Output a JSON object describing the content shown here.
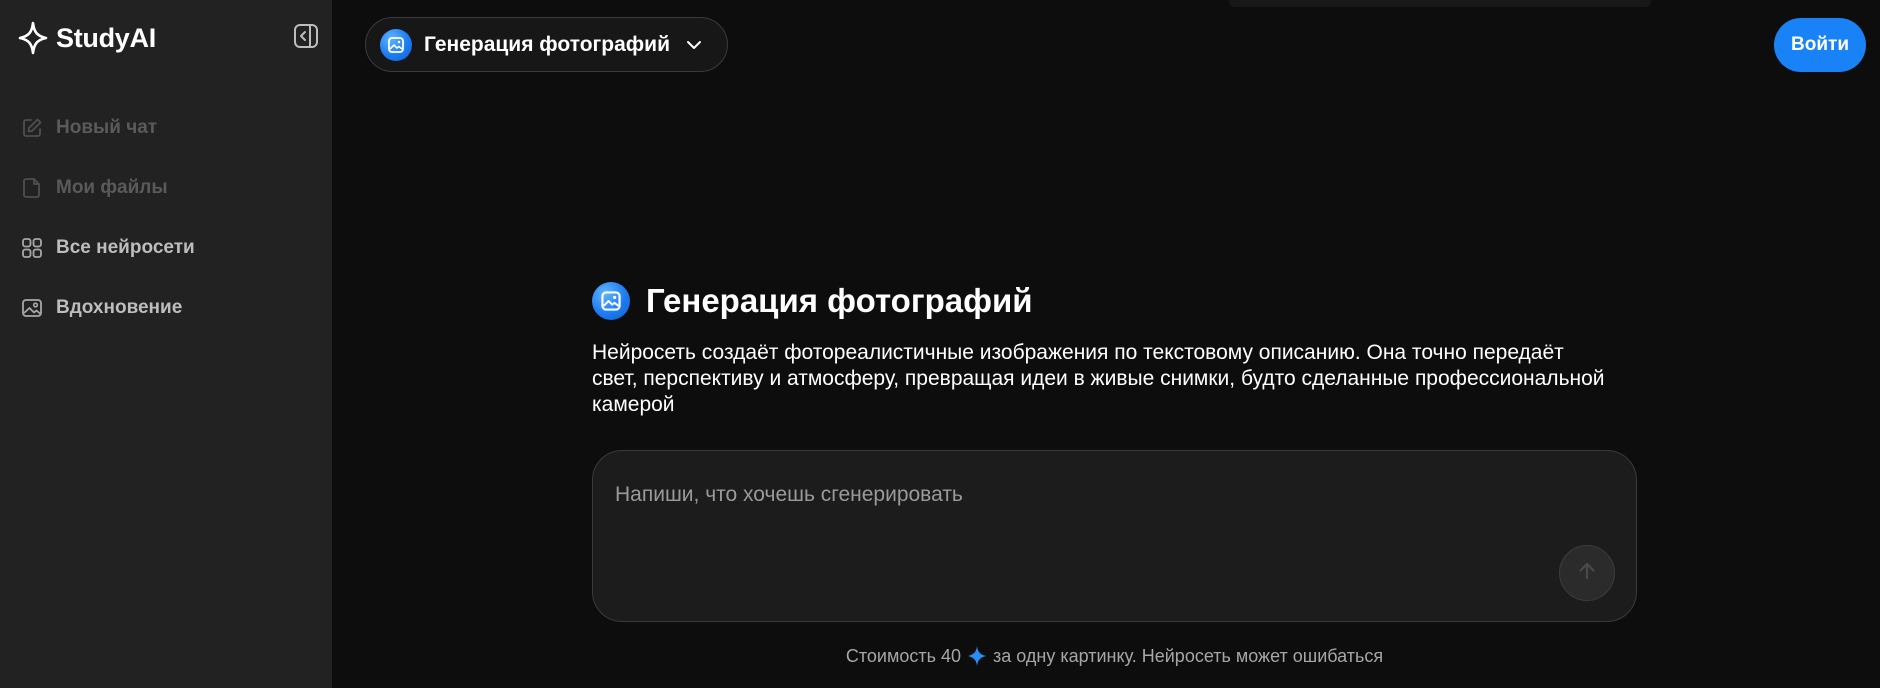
{
  "brand": {
    "name": "StudyAI"
  },
  "sidebar": {
    "items": [
      {
        "label": "Новый чат",
        "icon": "edit-icon",
        "state": "disabled"
      },
      {
        "label": "Мои файлы",
        "icon": "file-icon",
        "state": "disabled"
      },
      {
        "label": "Все нейросети",
        "icon": "grid-icon",
        "state": "enabled"
      },
      {
        "label": "Вдохновение",
        "icon": "image-icon",
        "state": "enabled"
      }
    ]
  },
  "header": {
    "model_select": {
      "label": "Генерация фотографий",
      "icon": "photo-badge-icon"
    },
    "login_label": "Войти"
  },
  "main": {
    "title": "Генерация фотографий",
    "description": "Нейросеть создаёт фотореалистичные изображения по текстовому описанию. Она точно передаёт свет, перспективу и атмосферу, превращая идеи в живые снимки, будто сделанные профессиональной камерой",
    "prompt": {
      "placeholder": "Напиши, что хочешь сгенерировать",
      "value": ""
    },
    "footnote": {
      "before": "Стоимость 40",
      "after": "за одну картинку. Нейросеть может ошибаться"
    }
  },
  "colors": {
    "accent": "#1a82f7",
    "sidebar_bg": "#222222",
    "main_bg": "#0d0d0d"
  }
}
